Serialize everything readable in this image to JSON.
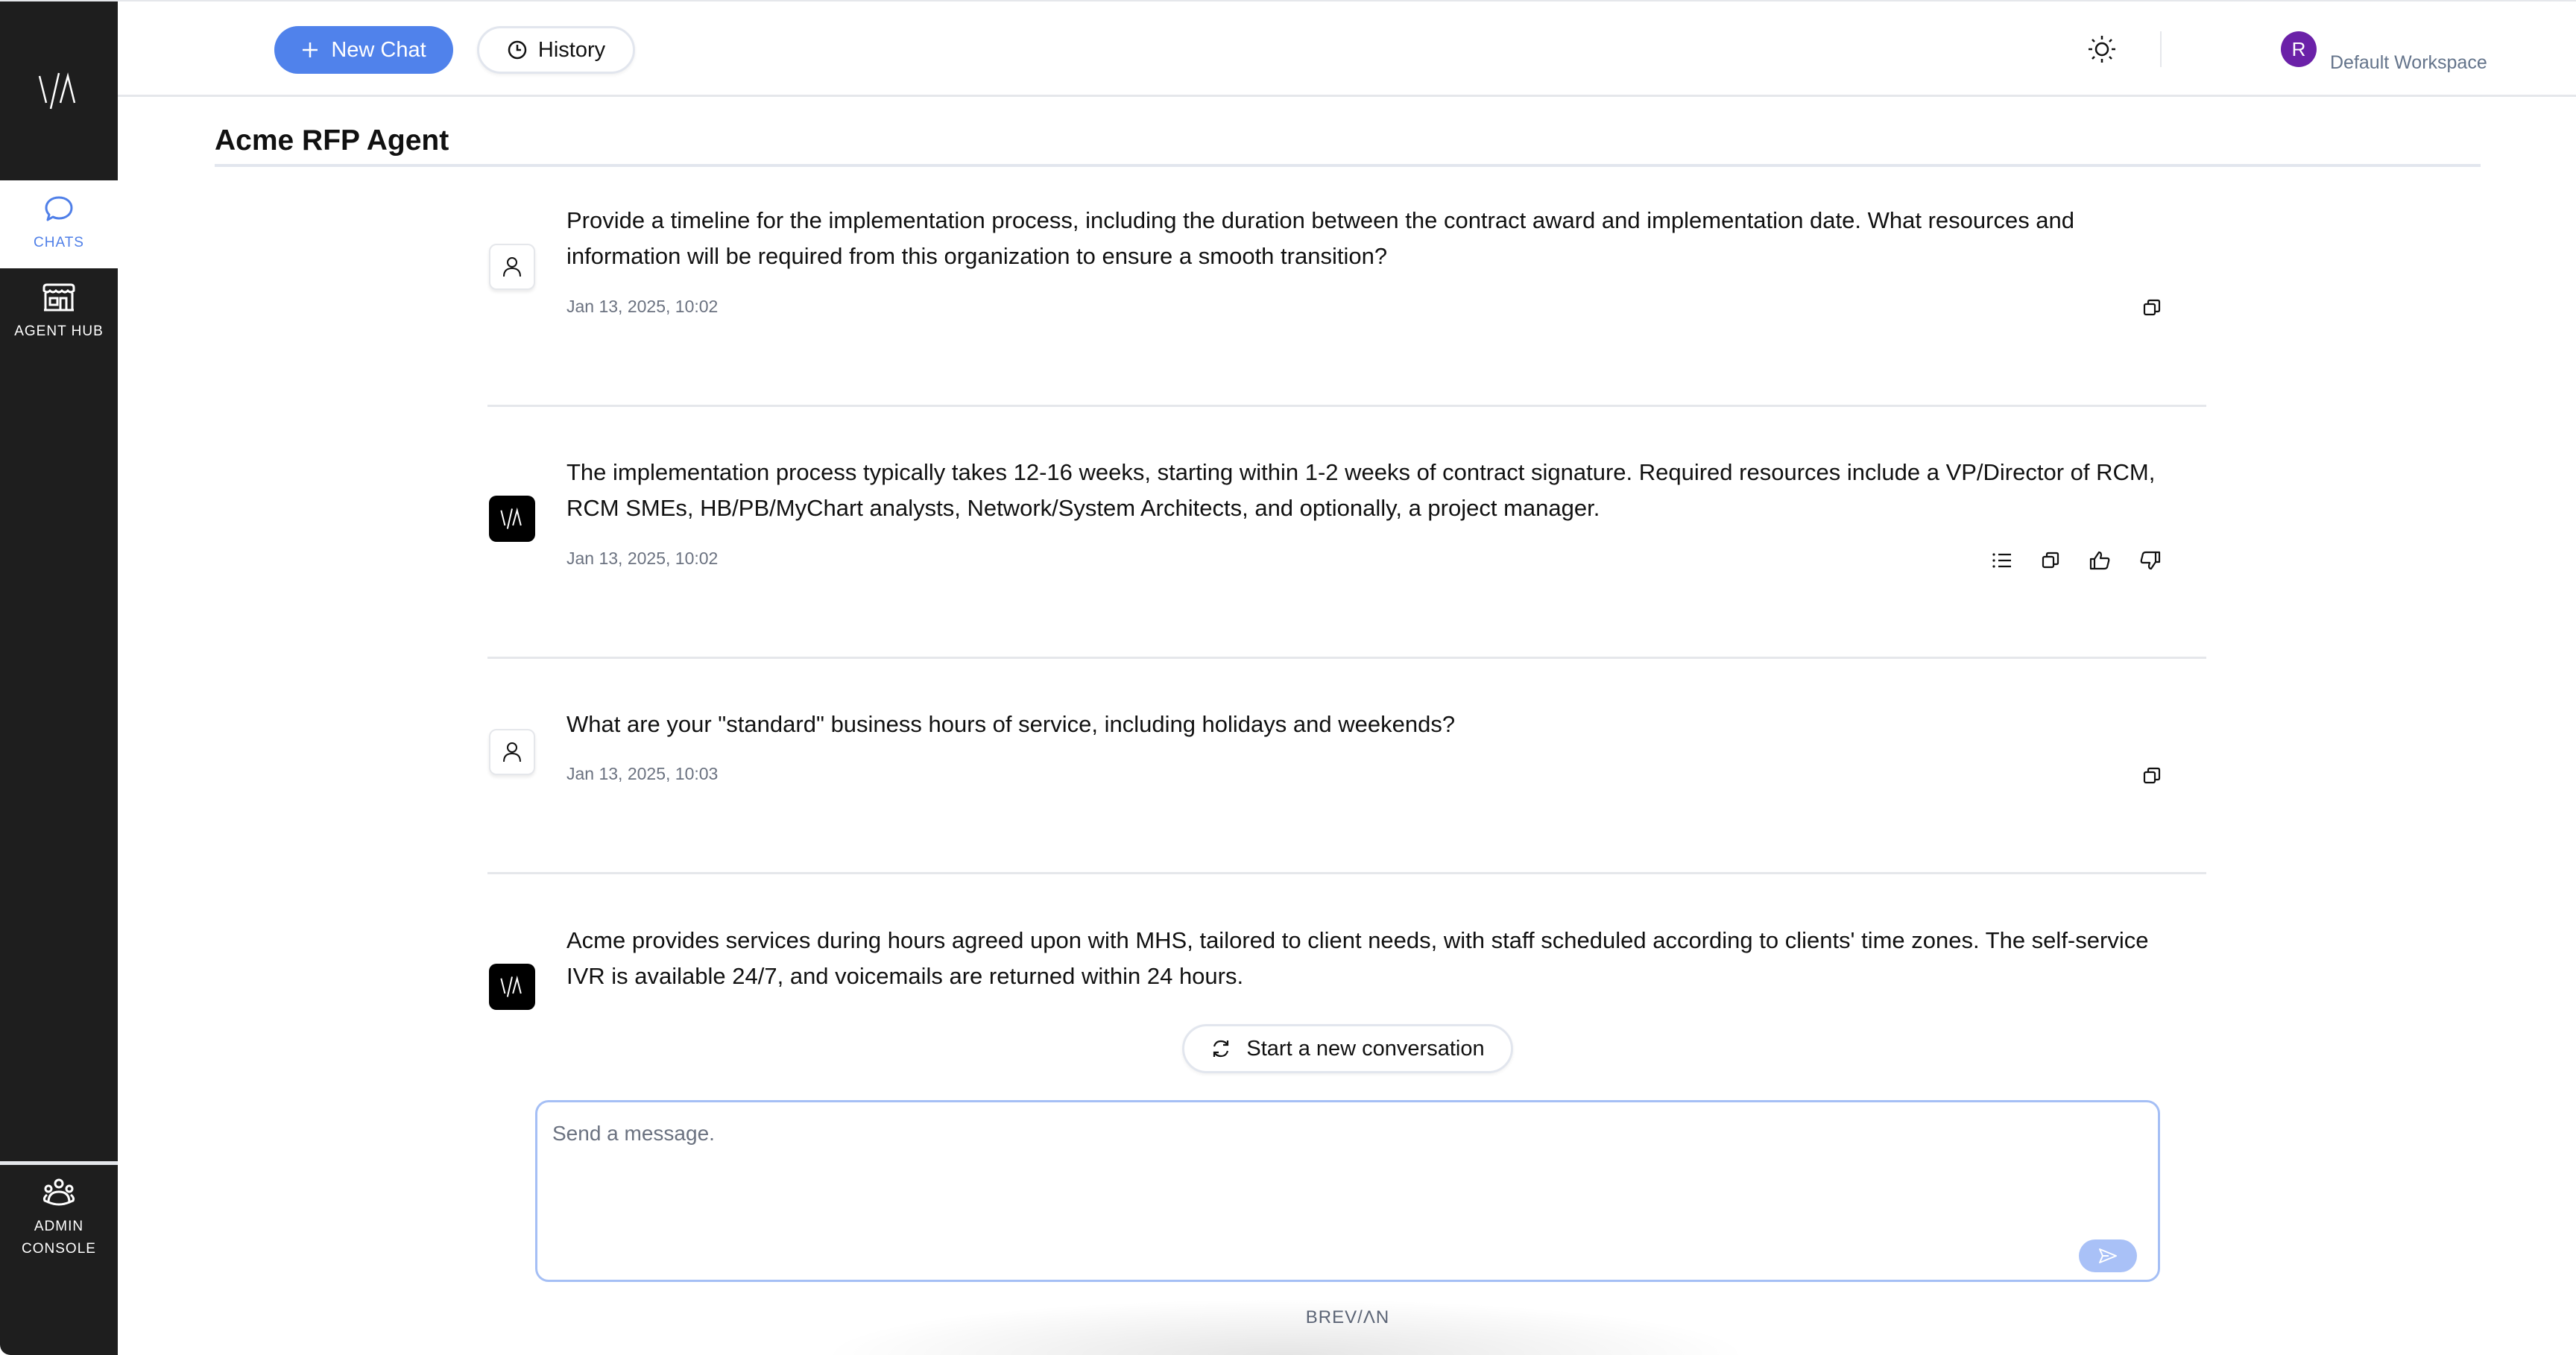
{
  "sidebar": {
    "logo": "V/Λ",
    "items": [
      {
        "label": "CHATS",
        "icon": "chat-bubble-icon",
        "active": true
      },
      {
        "label": "AGENT HUB",
        "icon": "storefront-icon",
        "active": false
      }
    ],
    "bottom_item": {
      "label_line1": "ADMIN",
      "label_line2": "CONSOLE",
      "icon": "users-group-icon"
    }
  },
  "header": {
    "new_chat_label": "New Chat",
    "history_label": "History",
    "theme_icon": "sun-icon",
    "avatar_initial": "R",
    "workspace_label": "Default Workspace",
    "accent_color": "#5082eb",
    "avatar_color": "#6b21a8"
  },
  "page": {
    "title": "Acme RFP Agent"
  },
  "messages": [
    {
      "role": "user",
      "text": "Provide a timeline for the implementation process, including the duration between the contract award and implementation date. What resources and information will be required from this organization to ensure a smooth transition?",
      "timestamp": "Jan 13, 2025, 10:02",
      "actions": [
        "copy"
      ]
    },
    {
      "role": "assistant",
      "text": "The implementation process typically takes 12-16 weeks, starting within 1-2 weeks of contract signature. Required resources include a VP/Director of RCM, RCM SMEs, HB/PB/MyChart analysts, Network/System Architects, and optionally, a project manager.",
      "timestamp": "Jan 13, 2025, 10:02",
      "actions": [
        "sources",
        "copy",
        "thumbs-up",
        "thumbs-down"
      ]
    },
    {
      "role": "user",
      "text": "What are your \"standard\" business hours of service, including holidays and weekends?",
      "timestamp": "Jan 13, 2025, 10:03",
      "actions": [
        "copy"
      ]
    },
    {
      "role": "assistant",
      "text": "Acme provides services during hours agreed upon with MHS, tailored to client needs, with staff scheduled according to clients' time zones. The self-service IVR is available 24/7, and voicemails are returned within 24 hours.",
      "timestamp": "",
      "actions": []
    }
  ],
  "restart_label": "Start a new conversation",
  "composer": {
    "placeholder": "Send a message.",
    "value": ""
  },
  "footer": {
    "brand": "BREV/ΛN"
  }
}
